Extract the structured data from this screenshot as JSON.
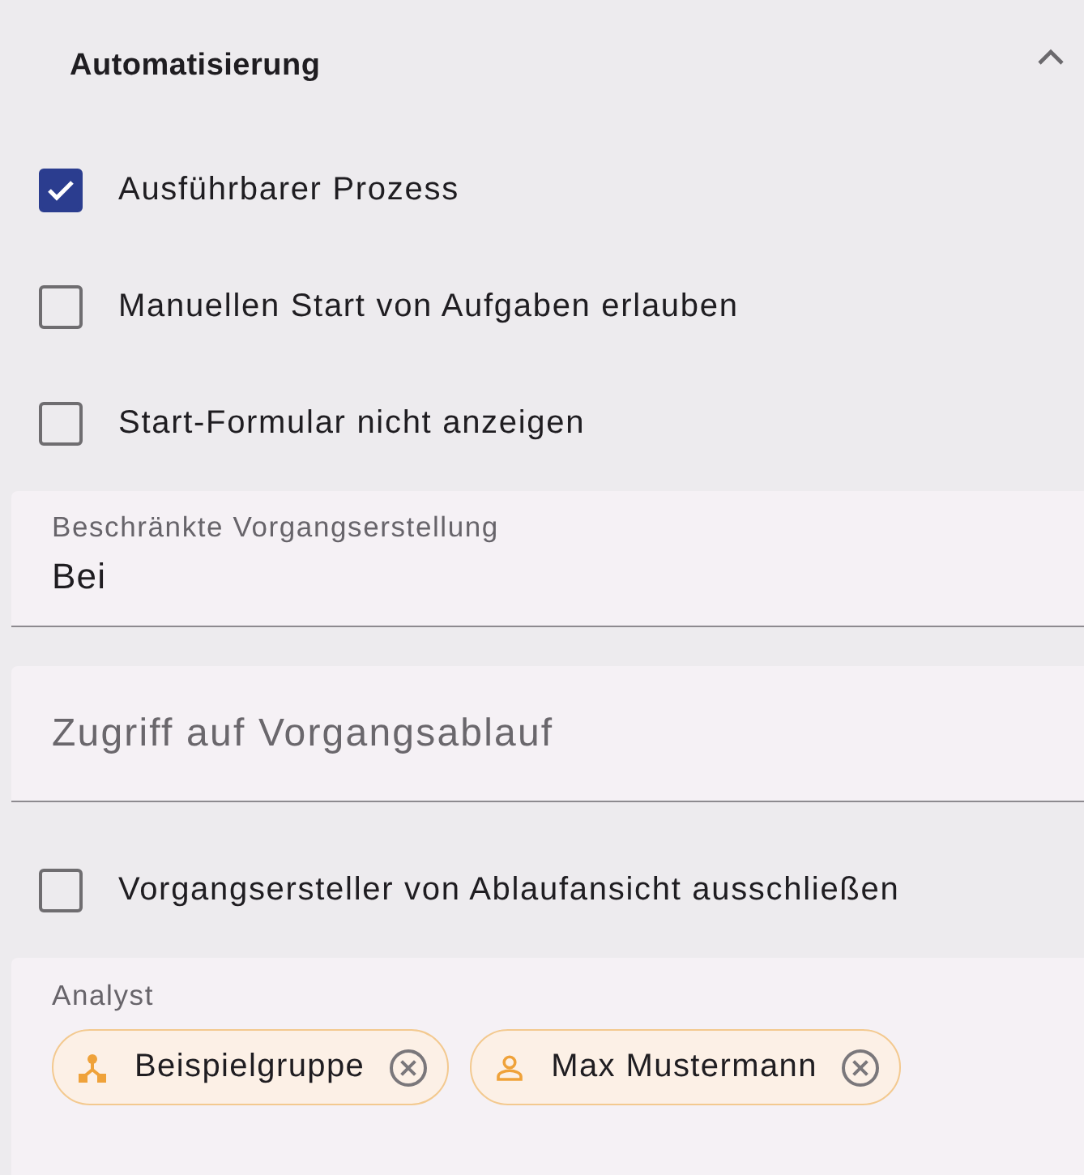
{
  "section": {
    "title": "Automatisierung",
    "expanded": true,
    "items": [
      {
        "kind": "checkbox",
        "label": "Ausführbarer Prozess",
        "checked": true
      },
      {
        "kind": "checkbox",
        "label": "Manuellen Start von Aufgaben erlauben",
        "checked": false
      },
      {
        "kind": "checkbox",
        "label": "Start-Formular nicht anzeigen",
        "checked": false
      },
      {
        "kind": "textfield",
        "label": "Beschränkte Vorgangserstellung",
        "value": "Bei"
      },
      {
        "kind": "textfield",
        "placeholder": "Zugriff auf Vorgangsablauf"
      },
      {
        "kind": "checkbox",
        "label": "Vorgangsersteller von Ablaufansicht ausschließen",
        "checked": false
      },
      {
        "kind": "chipfield",
        "label": "Analyst",
        "chips": [
          {
            "kind": "group",
            "label": "Beispielgruppe"
          },
          {
            "kind": "person",
            "label": "Max Mustermann"
          }
        ]
      }
    ]
  }
}
